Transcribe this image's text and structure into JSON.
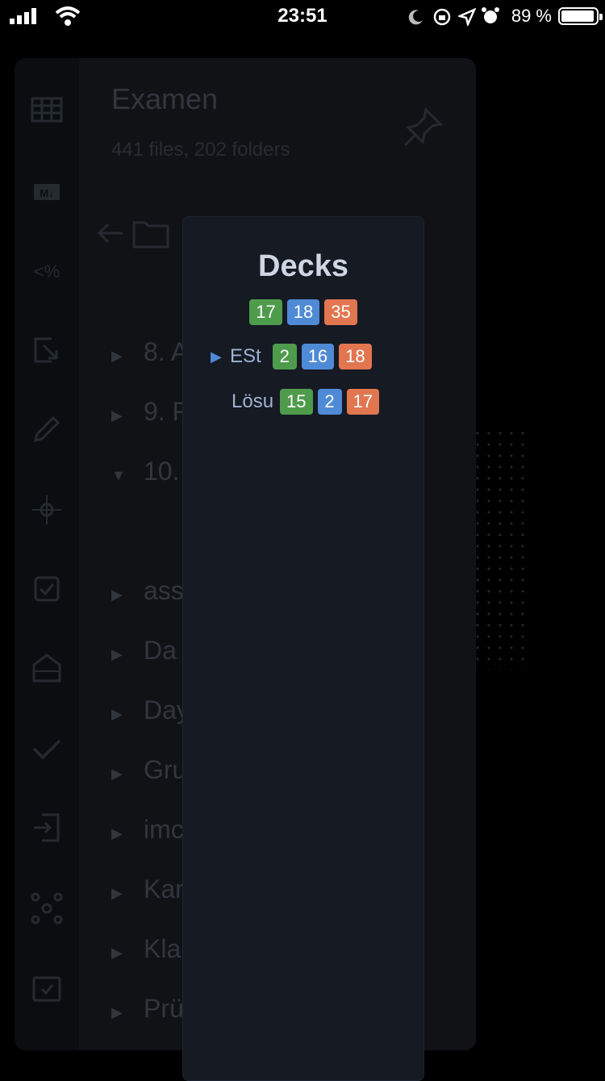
{
  "status_bar": {
    "time": "23:51",
    "battery": "89 %",
    "icons": [
      "signal-icon",
      "wifi-icon",
      "moon-icon",
      "orientation-lock-icon",
      "location-icon",
      "alarm-icon",
      "battery-icon"
    ]
  },
  "background_app": {
    "vault_title": "Examen",
    "vault_stats": "441 files, 202 folders",
    "rail_icons": [
      "table-icon",
      "markdown-icon",
      "template-icon",
      "export-icon",
      "edit-icon",
      "crosshair-icon",
      "checkbox-icon",
      "building-icon",
      "check-icon",
      "import-icon",
      "graph-icon",
      "calendar-check-icon"
    ],
    "tree_items": [
      {
        "label": "8. A"
      },
      {
        "label": "9. F"
      },
      {
        "label": "10."
      },
      {
        "label": "ass"
      },
      {
        "label": "Da"
      },
      {
        "label": "Day"
      },
      {
        "label": "Gru"
      },
      {
        "label": "imc"
      },
      {
        "label": "Kar"
      },
      {
        "label": "Kla"
      },
      {
        "label": "Prü"
      }
    ]
  },
  "decks_modal": {
    "title": "Decks",
    "totals": {
      "new": "17",
      "learning": "18",
      "due": "35"
    },
    "decks": [
      {
        "name": "ESt",
        "expandable": true,
        "new": "2",
        "learning": "16",
        "due": "18"
      },
      {
        "name": "Lösu",
        "expandable": false,
        "new": "15",
        "learning": "2",
        "due": "17"
      }
    ]
  },
  "colors": {
    "green": "#4f9b4c",
    "blue": "#4f8ad6",
    "orange": "#e27650"
  }
}
